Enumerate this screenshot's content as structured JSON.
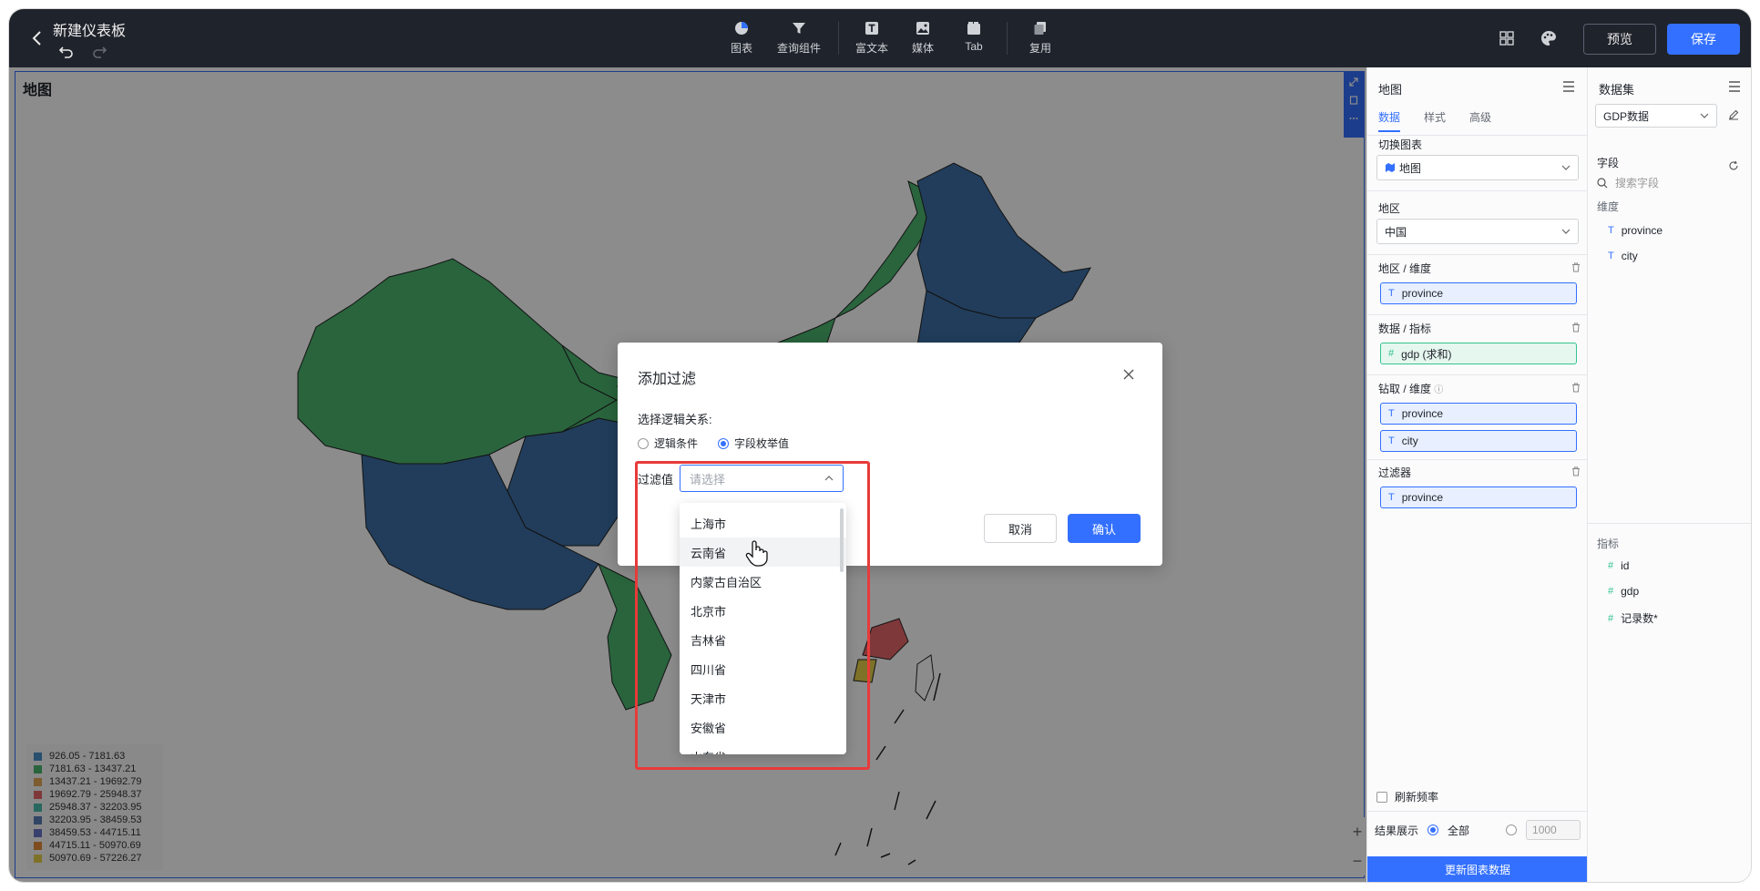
{
  "header": {
    "title": "新建仪表板",
    "tools": [
      {
        "label": "图表",
        "icon": "pie-chart-icon"
      },
      {
        "label": "查询组件",
        "icon": "filter-icon"
      },
      {
        "label": "富文本",
        "icon": "rich-text-icon"
      },
      {
        "label": "媒体",
        "icon": "image-icon"
      },
      {
        "label": "Tab",
        "icon": "tab-icon"
      },
      {
        "label": "复用",
        "icon": "copy-icon"
      }
    ],
    "preview_label": "预览",
    "save_label": "保存"
  },
  "chart": {
    "title": "地图",
    "legend": [
      {
        "range": "926.05 - 7181.63",
        "color": "#4a90c9"
      },
      {
        "range": "7181.63 - 13437.21",
        "color": "#4bb66f"
      },
      {
        "range": "13437.21 - 19692.79",
        "color": "#e3a857"
      },
      {
        "range": "19692.79 - 25948.37",
        "color": "#e8676a"
      },
      {
        "range": "25948.37 - 32203.95",
        "color": "#4bbdb0"
      },
      {
        "range": "32203.95 - 38459.53",
        "color": "#5a7fb8"
      },
      {
        "range": "38459.53 - 44715.11",
        "color": "#6a76c9"
      },
      {
        "range": "44715.11 - 50970.69",
        "color": "#e58a3a"
      },
      {
        "range": "50970.69 - 57226.27",
        "color": "#e6cf4a"
      }
    ]
  },
  "config_panel": {
    "title": "地图",
    "tabs": [
      "数据",
      "样式",
      "高级"
    ],
    "switch_chart_label": "切换图表",
    "switch_chart_value": "地图",
    "region_label": "地区",
    "region_value": "中国",
    "region_dim_label": "地区 / 维度",
    "region_dim_field": "province",
    "metric_label": "数据 / 指标",
    "metric_field": "gdp (求和)",
    "drill_label": "钻取 / 维度",
    "drill_fields": [
      "province",
      "city"
    ],
    "filter_label": "过滤器",
    "filter_field": "province",
    "refresh_label": "刷新频率",
    "result_label": "结果展示",
    "result_all": "全部",
    "result_limit": "1000",
    "update_button": "更新图表数据"
  },
  "dataset_panel": {
    "title": "数据集",
    "dataset": "GDP数据",
    "fields_label": "字段",
    "search_placeholder": "搜索字段",
    "dims_label": "维度",
    "dims": [
      "province",
      "city"
    ],
    "metrics_label": "指标",
    "metrics": [
      "id",
      "gdp",
      "记录数*"
    ]
  },
  "modal": {
    "title": "添加过滤",
    "logic_label": "选择逻辑关系:",
    "option_condition": "逻辑条件",
    "option_enum": "字段枚举值",
    "filter_label": "过滤值",
    "select_placeholder": "请选择",
    "cancel_label": "取消",
    "ok_label": "确认",
    "options": [
      "上海市",
      "云南省",
      "内蒙古自治区",
      "北京市",
      "吉林省",
      "四川省",
      "天津市",
      "安徽省",
      "山东省"
    ]
  }
}
